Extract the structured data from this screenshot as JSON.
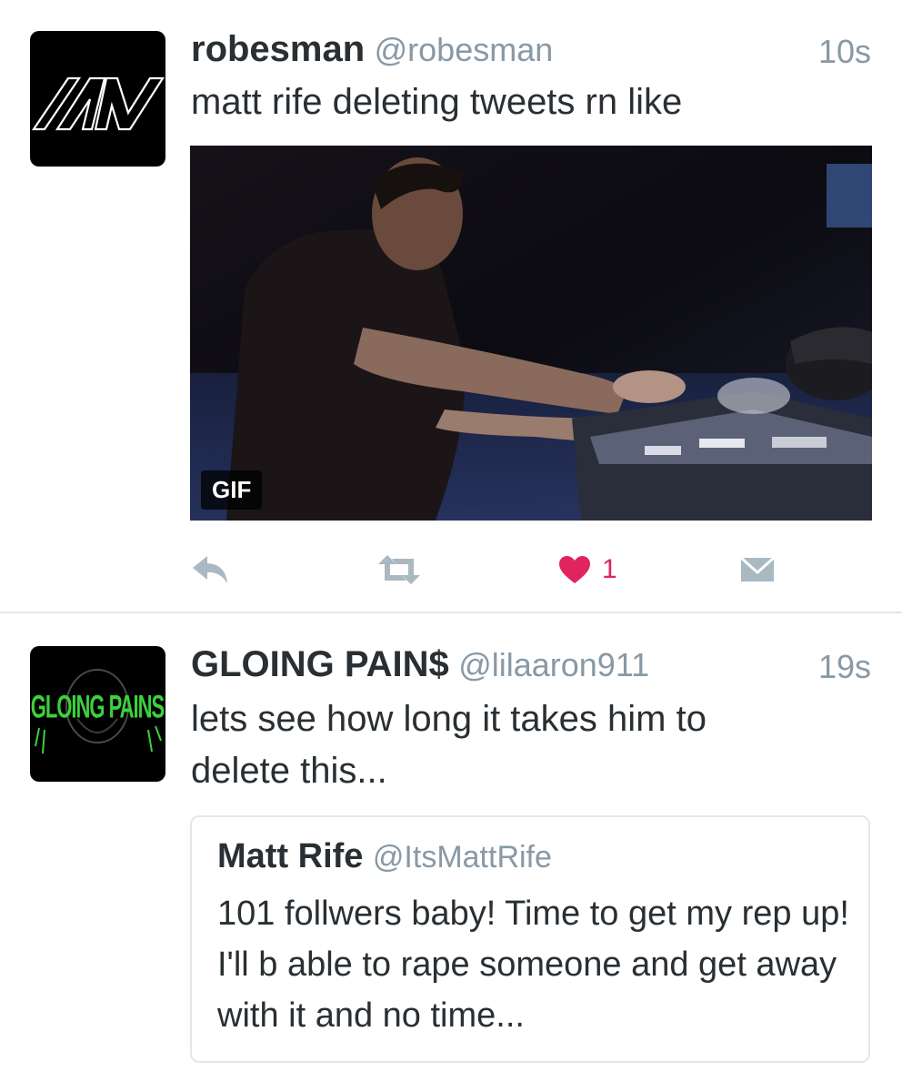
{
  "tweets": [
    {
      "name": "robesman",
      "handle": "@robesman",
      "time": "10s",
      "text": "matt rife deleting tweets rn like",
      "avatar_icon": "nw-monogram-logo",
      "media": {
        "badge": "GIF"
      },
      "actions": {
        "like_count": "1"
      }
    },
    {
      "name": "GLOING PAIN$",
      "handle": "@lilaaron911",
      "time": "19s",
      "text": "lets see how long it takes him to delete this...",
      "avatar_icon": "growing-pains-logo",
      "avatar_text": "GLOING PAINS",
      "quote": {
        "name": "Matt Rife",
        "handle": "@ItsMattRife",
        "text": "101 follwers baby! Time to get my rep up! I'll b able to rape someone and get away with it and no time..."
      }
    }
  ],
  "colors": {
    "text": "#292f33",
    "secondary": "#8899a6",
    "like_active": "#e0245e",
    "action_gray": "#aab8c2",
    "divider": "#e1e8ed",
    "avatar_green": "#3bd13b"
  }
}
